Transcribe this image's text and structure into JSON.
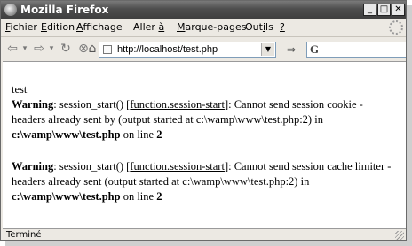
{
  "window": {
    "title": "Mozilla Firefox",
    "min": "_",
    "max": "□",
    "close": "✕"
  },
  "menu": [
    {
      "pre": "",
      "key": "F",
      "post": "ichier"
    },
    {
      "pre": "",
      "key": "E",
      "post": "dition"
    },
    {
      "pre": "",
      "key": "A",
      "post": "ffichage"
    },
    {
      "pre": "Aller ",
      "key": "à",
      "post": ""
    },
    {
      "pre": "",
      "key": "M",
      "post": "arque-pages"
    },
    {
      "pre": "Out",
      "key": "i",
      "post": "ls"
    },
    {
      "pre": "",
      "key": "?",
      "post": ""
    }
  ],
  "nav": {
    "url": "http://localhost/test.php",
    "search_glyph": "G"
  },
  "icons": {
    "back": "⇦",
    "back_drop": "▾",
    "forward": "⇨",
    "forward_drop": "▾",
    "reload": "↻",
    "stop": "⊗",
    "home": "⌂",
    "go": "⇒",
    "url_drop": "▼"
  },
  "page": {
    "first_line": "test",
    "warnings": [
      {
        "label": "Warning",
        "pre": ": session_start() [",
        "link": "function.session-start",
        "post": "]: Cannot send session cookie - headers already sent by (output started at c:\\wamp\\www\\test.php:2) in",
        "file": "c:\\wamp\\www\\test.php",
        "online": " on line ",
        "line": "2"
      },
      {
        "label": "Warning",
        "pre": ": session_start() [",
        "link": "function.session-start",
        "post": "]: Cannot send session cache limiter - headers already sent (output started at c:\\wamp\\www\\test.php:2) in",
        "file": "c:\\wamp\\www\\test.php",
        "online": " on line ",
        "line": "2"
      }
    ]
  },
  "status": {
    "text": "Terminé"
  }
}
